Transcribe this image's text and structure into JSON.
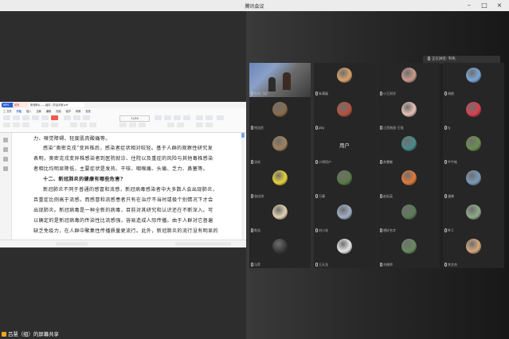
{
  "window": {
    "title": "腾讯会议",
    "min_icon": "minimize-icon",
    "max_icon": "maximize-icon",
    "close_icon": "close-icon"
  },
  "hint": {
    "text": "正在讲话: 韦伟;"
  },
  "share": {
    "label": "吕慧（组）的屏幕共享"
  },
  "doc": {
    "tabs": [
      "稻壳",
      "新冠肺炎——疫情...防治手册.pdf"
    ],
    "menu": [
      "三 文件",
      "开始",
      "插入",
      "注释",
      "编辑",
      "页面",
      "保护",
      "转换",
      "查找"
    ],
    "active_menu": "开始",
    "page_indicator": "11/59",
    "lines": [
      "力、嗅觉障碍、轻度肌肉酸痛等。",
      "感染“奥密克戎”变异株后，感染者症状相对较轻。基于人群的观察性研究发",
      "表明，奥密克戎变异株感染者到医院就诊、住院以及重症的风险与其他毒株感染",
      "者相比均明显降低，主要症状是发热、干咳、咽喉痛、头痛、乏力、鼻塞等。",
      "十二、新冠肺炎的健康有哪些危害?",
      "新冠肺炎不同于普通的感冒和流感，新冠病毒感染者中大多数人会出现肺炎，",
      "且重症比例高于流感。而感冒和流感患者只有在治疗不当时或极个别情况下才会",
      "出现肺炎。新冠病毒是一种全新的病毒，目前对其研究和认识还在不断深入。可",
      "以确定的是新冠病毒的传染性比流感强，容易造成人际传播。由于人群对它普遍",
      "缺乏免疫力，在人群中聚集性传播质量更流行。此外，新冠肺炎的流行没有明显的"
    ]
  },
  "participants": [
    {
      "name": "韦伟（组）",
      "kind": "camera",
      "color": ""
    },
    {
      "name": "朱满磊",
      "kind": "avatar",
      "color": "#d9a36a"
    },
    {
      "name": "小王同学",
      "kind": "avatar",
      "color": "#c99a8a"
    },
    {
      "name": "胡俊",
      "kind": "avatar",
      "color": "#7aa6d6"
    },
    {
      "name": "钱浩民",
      "kind": "avatar",
      "color": "#8b6b4a"
    },
    {
      "name": "pby",
      "kind": "avatar",
      "color": "#b5523f"
    },
    {
      "name": "江西南昌-王强",
      "kind": "avatar",
      "color": "#e7c1b6"
    },
    {
      "name": "ly",
      "kind": "avatar",
      "color": "#d94050"
    },
    {
      "name": "沈欢",
      "kind": "avatar",
      "color": "#a2825e"
    },
    {
      "name": "小明用户",
      "kind": "text",
      "color": "",
      "big": "用户"
    },
    {
      "name": "苏慧敏",
      "kind": "avatar",
      "color": "#4a8a8a"
    },
    {
      "name": "牛牛蛙",
      "kind": "avatar",
      "color": "#6b8f4e"
    },
    {
      "name": "张佳琪",
      "kind": "avatar",
      "color": "#e8d23b"
    },
    {
      "name": "万康",
      "kind": "avatar",
      "color": "#5c7a46"
    },
    {
      "name": "赵彩英",
      "kind": "avatar",
      "color": "#e07a3a"
    },
    {
      "name": "潘晓",
      "kind": "avatar",
      "color": "#7a9ab8"
    },
    {
      "name": "陈浩",
      "kind": "avatar",
      "color": "#e2d3b0"
    },
    {
      "name": "刘小花",
      "kind": "avatar",
      "color": "#9fb0c6"
    },
    {
      "name": "想好名字",
      "kind": "avatar",
      "color": "#5d7a5a"
    },
    {
      "name": "M.C",
      "kind": "avatar",
      "color": "#8faa8a"
    },
    {
      "name": "冯萃",
      "kind": "avatar",
      "color": "#3a3a3a"
    },
    {
      "name": "王天龙",
      "kind": "avatar",
      "color": "#e6e6e6"
    },
    {
      "name": "刘建师",
      "kind": "avatar",
      "color": "#6a8a5e"
    },
    {
      "name": "李文杰",
      "kind": "avatar",
      "color": "#d7a77d"
    }
  ]
}
